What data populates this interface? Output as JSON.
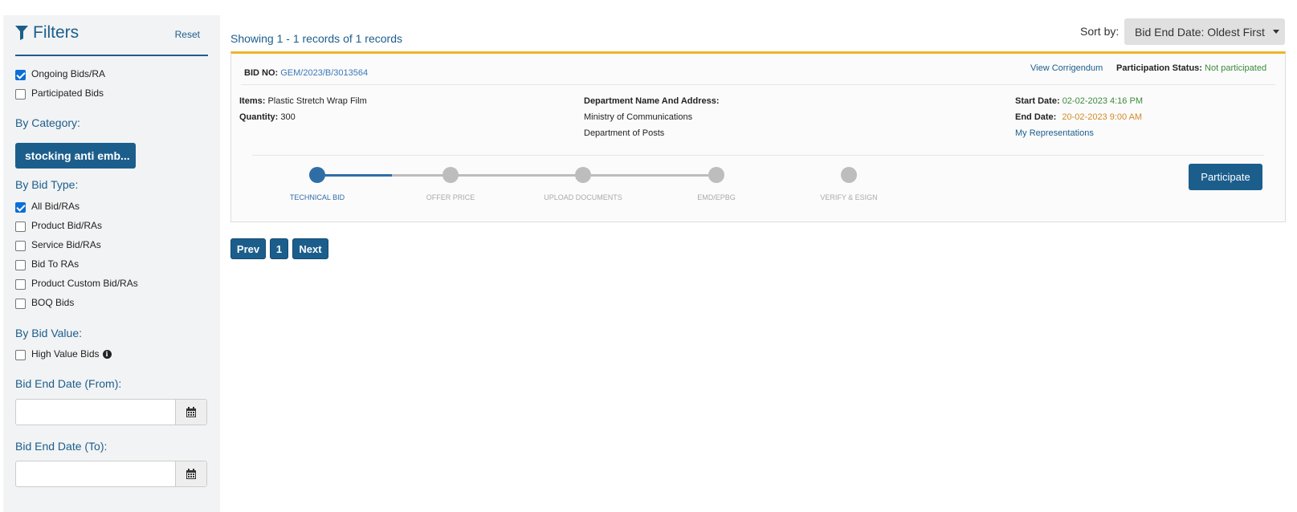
{
  "filters": {
    "title": "Filters",
    "reset_label": "Reset",
    "status_options": [
      {
        "label": "Ongoing Bids/RA",
        "checked": true
      },
      {
        "label": "Participated Bids",
        "checked": false
      }
    ],
    "category_label": "By Category:",
    "category_value": "stocking anti emb...",
    "bid_type_label": "By Bid Type:",
    "bid_types": [
      {
        "label": "All Bid/RAs",
        "checked": true
      },
      {
        "label": "Product Bid/RAs",
        "checked": false
      },
      {
        "label": "Service Bid/RAs",
        "checked": false
      },
      {
        "label": "Bid To RAs",
        "checked": false
      },
      {
        "label": "Product Custom Bid/RAs",
        "checked": false
      },
      {
        "label": "BOQ Bids",
        "checked": false
      }
    ],
    "bid_value_label": "By Bid Value:",
    "high_value_label": "High Value Bids",
    "high_value_checked": false,
    "end_date_from_label": "Bid End Date (From):",
    "end_date_from_value": "",
    "end_date_to_label": "Bid End Date (To):",
    "end_date_to_value": ""
  },
  "results": {
    "showing_text": "Showing 1 - 1 records of 1 records",
    "sort_label": "Sort by:",
    "sort_value": "Bid End Date: Oldest First"
  },
  "bid": {
    "bid_no_label": "BID NO:",
    "bid_no": "GEM/2023/B/3013564",
    "corrigendum_label": "View Corrigendum",
    "participation_label": "Participation Status:",
    "participation_value": "Not participated",
    "items_label": "Items:",
    "items_value": "Plastic Stretch Wrap Film",
    "quantity_label": "Quantity:",
    "quantity_value": "300",
    "dept_label": "Department Name And Address:",
    "dept_line1": "Ministry of Communications",
    "dept_line2": "Department of Posts",
    "start_label": "Start Date:",
    "start_value": "02-02-2023 4:16 PM",
    "end_label": "End Date:",
    "end_value": "20-02-2023 9:00 AM",
    "representations_label": "My Representations",
    "steps": [
      "TECHNICAL BID",
      "OFFER PRICE",
      "UPLOAD DOCUMENTS",
      "EMD/EPBG",
      "VERIFY & ESIGN"
    ],
    "active_step": 0,
    "participate_label": "Participate"
  },
  "pagination": {
    "prev_label": "Prev",
    "page": "1",
    "next_label": "Next"
  },
  "colors": {
    "primary": "#1b5e8c",
    "accent_border": "#f0b428",
    "start_date": "#3c8a3c",
    "end_date": "#d08c2a"
  }
}
